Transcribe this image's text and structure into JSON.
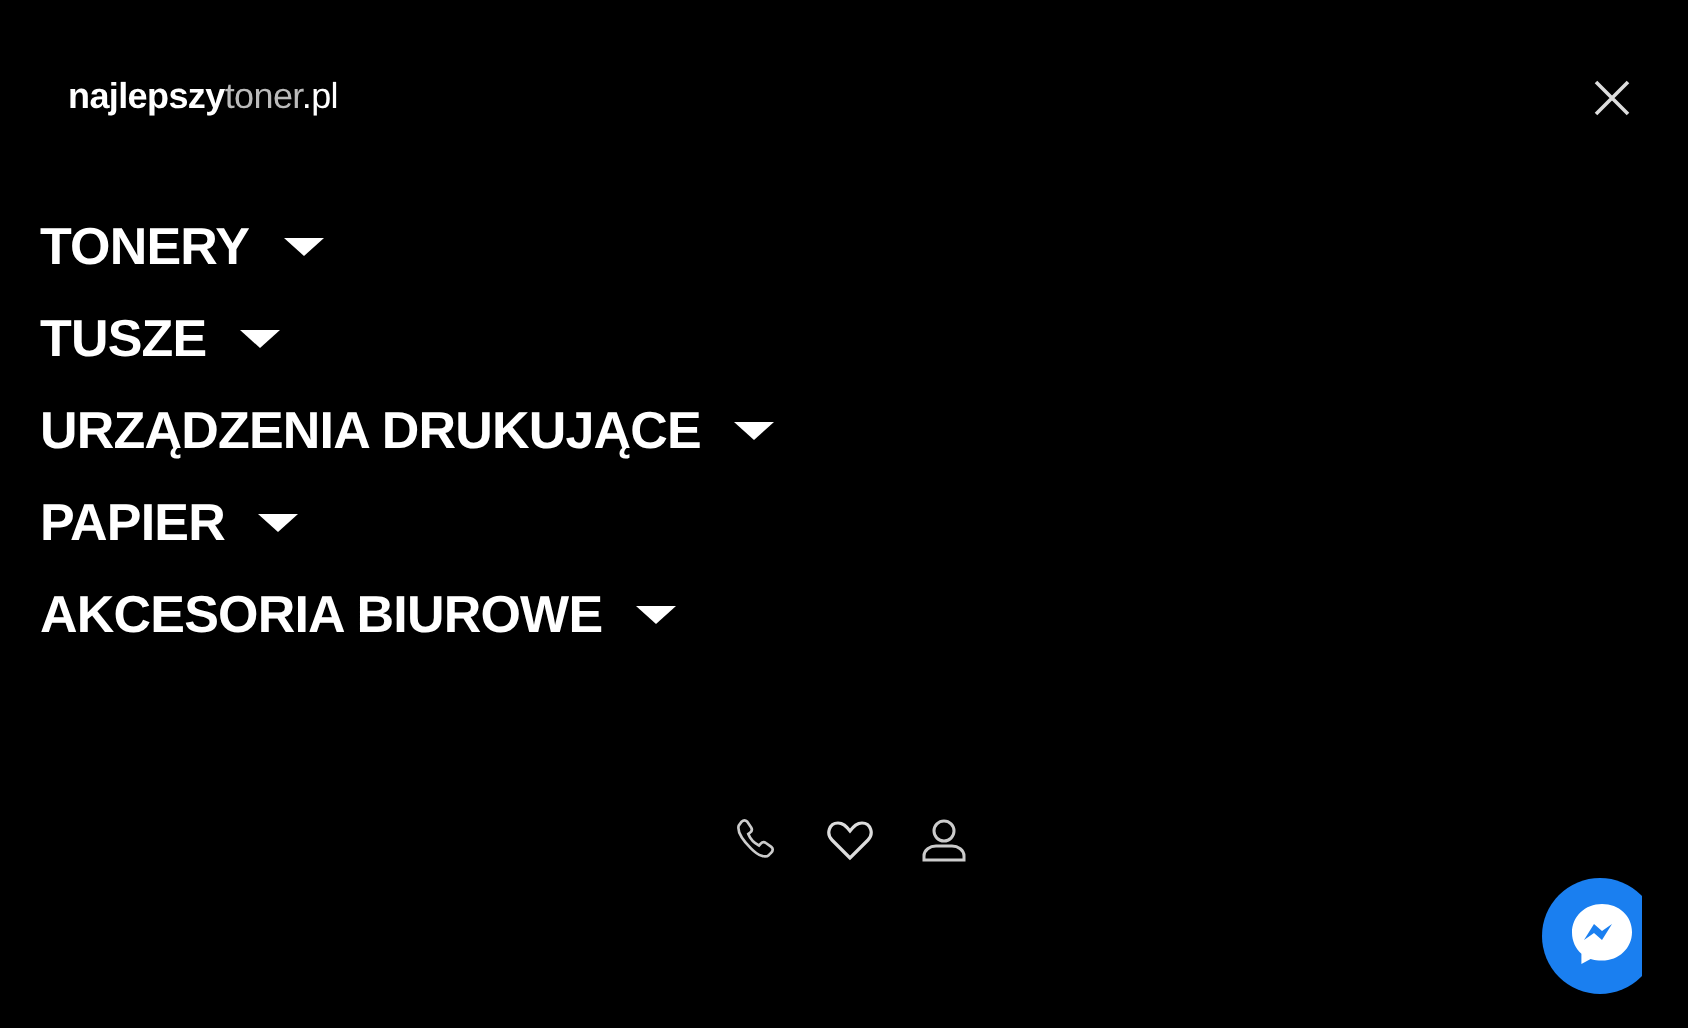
{
  "logo": {
    "main": "najlepszy",
    "light": "toner",
    "suffix": ".pl"
  },
  "menu": [
    {
      "label": "TONERY"
    },
    {
      "label": "TUSZE"
    },
    {
      "label": "URZĄDZENIA DRUKUJĄCE"
    },
    {
      "label": "PAPIER"
    },
    {
      "label": "AKCESORIA BIUROWE"
    }
  ]
}
